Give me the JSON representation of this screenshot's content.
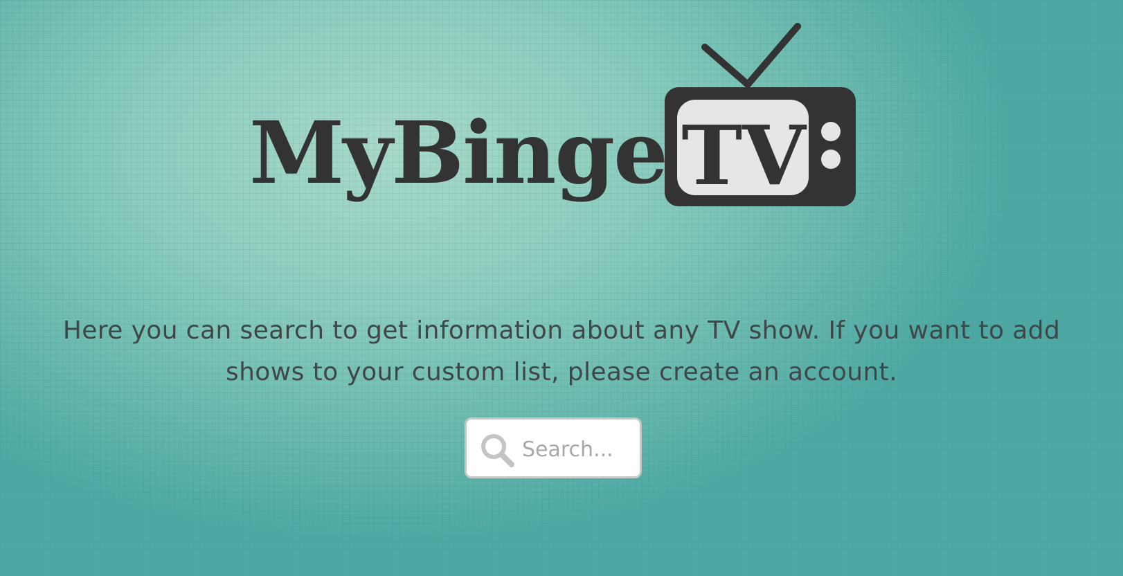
{
  "brand": {
    "wordmark": "MyBinge",
    "tv_label": "TV"
  },
  "intro": {
    "text": "Here you can search to get information about any TV show. If you want to add shows to your custom list, please create an account."
  },
  "search": {
    "placeholder": "Search...",
    "value": "",
    "icon": "search-icon"
  },
  "colors": {
    "background": "#7dc4b6",
    "logo": "#333333",
    "text": "#3f4748",
    "search_border": "#c8c8c8"
  }
}
